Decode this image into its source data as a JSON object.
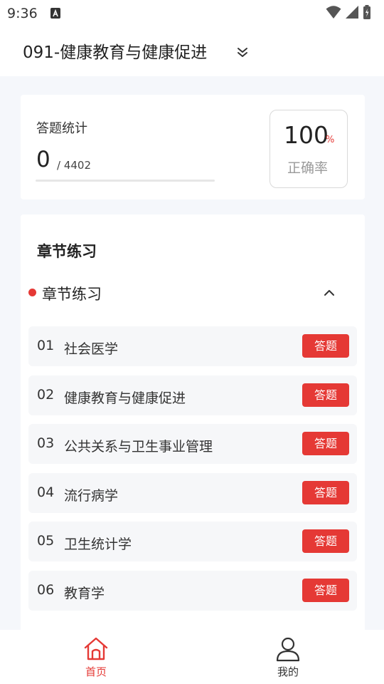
{
  "status_bar": {
    "time": "9:36"
  },
  "header": {
    "subject_title": "091-健康教育与健康促进",
    "dropdown_icon": "double-chevron-down-icon"
  },
  "stats": {
    "label": "答题统计",
    "answered": "0",
    "separator_total": "/ 4402",
    "progress_fraction": 0,
    "rate_value": "100",
    "rate_unit": "%",
    "rate_label": "正确率"
  },
  "chapter_section": {
    "title": "章节练习",
    "group_title": "章节练习",
    "collapse_icon": "chevron-up-icon",
    "items": [
      {
        "index": "01",
        "name": "社会医学",
        "button_label": "答题"
      },
      {
        "index": "02",
        "name": "健康教育与健康促进",
        "button_label": "答题"
      },
      {
        "index": "03",
        "name": "公共关系与卫生事业管理",
        "button_label": "答题"
      },
      {
        "index": "04",
        "name": "流行病学",
        "button_label": "答题"
      },
      {
        "index": "05",
        "name": "卫生统计学",
        "button_label": "答题"
      },
      {
        "index": "06",
        "name": "教育学",
        "button_label": "答题"
      }
    ]
  },
  "bottom_nav": {
    "home_label": "首页",
    "mine_label": "我的"
  },
  "colors": {
    "accent": "#e53935",
    "background": "#f5f7fb",
    "card": "#ffffff",
    "row_background": "#f6f7f9"
  }
}
